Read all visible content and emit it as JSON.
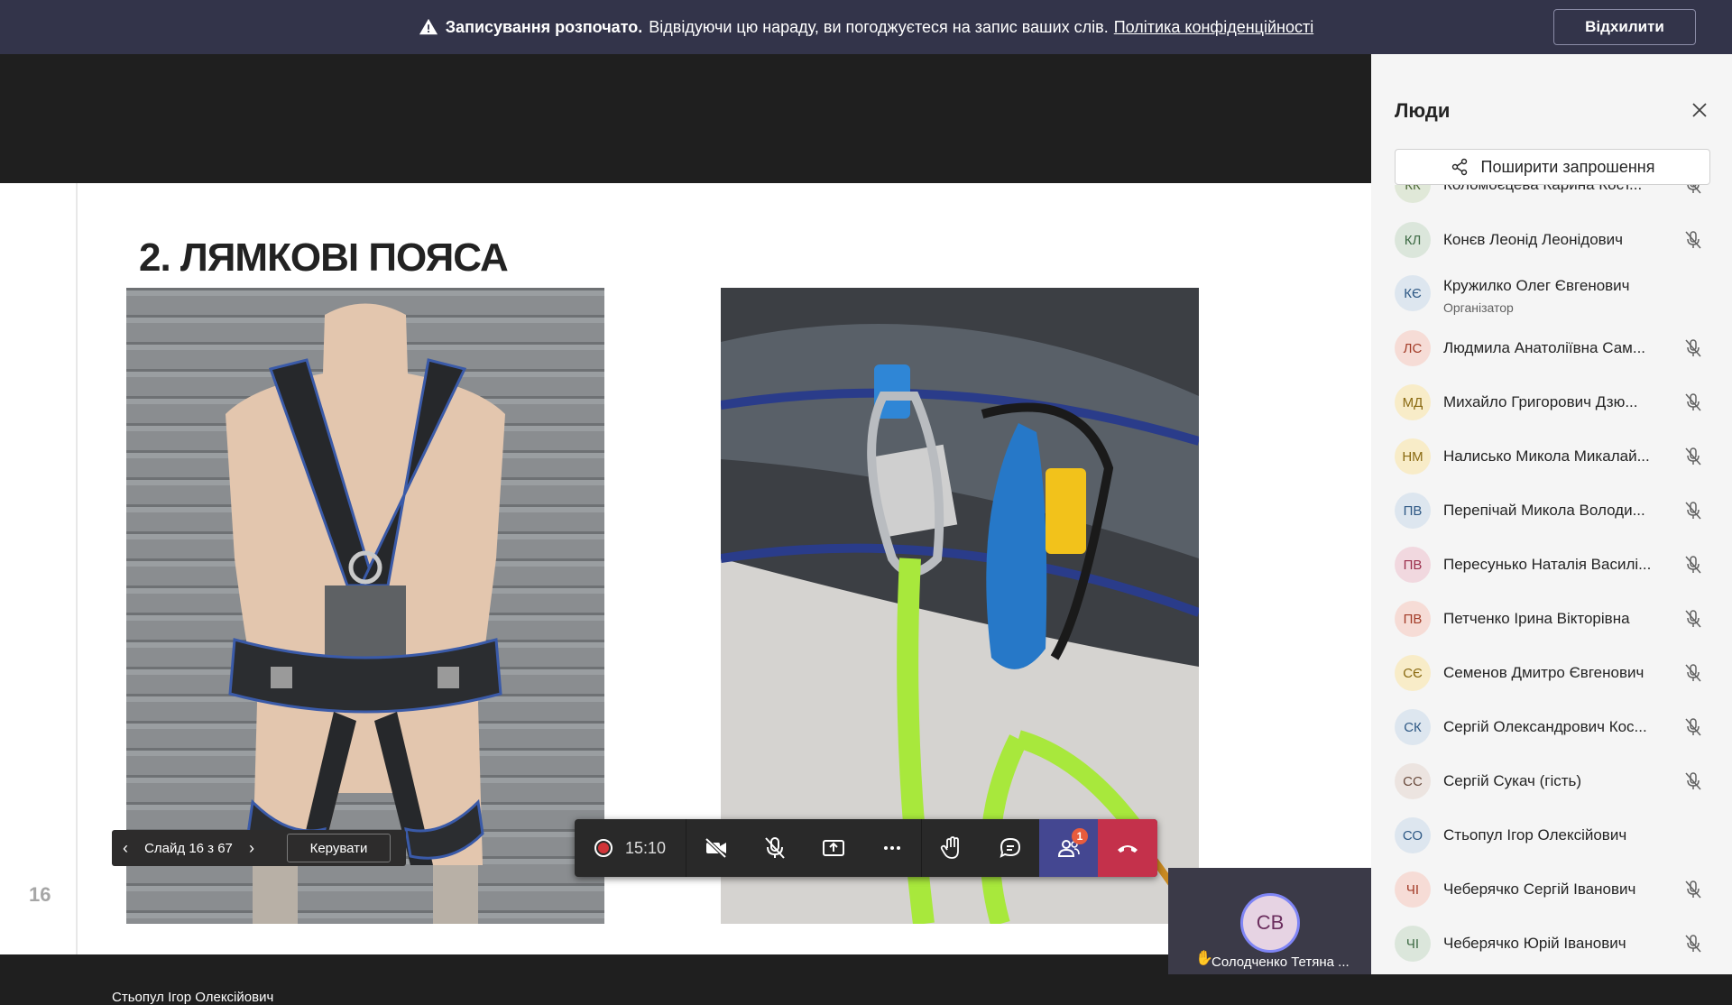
{
  "banner": {
    "bold": "Записування розпочато.",
    "text": "Відвідуючи цю нараду, ви погоджуєтеся на запис ваших слів.",
    "policy": "Політика конфіденційності",
    "dismiss": "Відхилити"
  },
  "slide": {
    "title": "2. ЛЯМКОВІ ПОЯСА",
    "number": "16"
  },
  "slidenav": {
    "counter": "Слайд 16 з 67",
    "manage": "Керувати"
  },
  "presenter": "Стьопул Ігор Олексійович",
  "controls": {
    "timer": "15:10",
    "people_badge": "1"
  },
  "tile": {
    "initials": "СВ",
    "name": "Солодченко Тетяна ..."
  },
  "panel": {
    "title": "Люди",
    "share": "Поширити запрошення",
    "people": [
      {
        "initials": "КК",
        "name": "Коломоєцева Карина Кост...",
        "color": "#e0e8d8",
        "fg": "#4f6b3a",
        "muted": true,
        "role": ""
      },
      {
        "initials": "КЛ",
        "name": "Конєв Леонід Леонідович",
        "color": "#dbe6db",
        "fg": "#3e6b45",
        "muted": true,
        "role": ""
      },
      {
        "initials": "КЄ",
        "name": "Кружилко Олег Євгенович",
        "color": "#dde6ef",
        "fg": "#2f5985",
        "muted": false,
        "role": "Організатор"
      },
      {
        "initials": "ЛС",
        "name": "Людмила Анатоліївна Сам...",
        "color": "#f6dcd6",
        "fg": "#a33c28",
        "muted": true,
        "role": ""
      },
      {
        "initials": "МД",
        "name": "Михайло Григорович Дзю...",
        "color": "#f8ecc8",
        "fg": "#8a6a12",
        "muted": true,
        "role": ""
      },
      {
        "initials": "НМ",
        "name": "Налисько Микола Микалай...",
        "color": "#f8ecc8",
        "fg": "#8a6a12",
        "muted": true,
        "role": ""
      },
      {
        "initials": "ПВ",
        "name": "Перепічай Микола Володи...",
        "color": "#dde6ef",
        "fg": "#2f5985",
        "muted": true,
        "role": ""
      },
      {
        "initials": "ПВ",
        "name": "Пересунько Наталія Василі...",
        "color": "#f1d8df",
        "fg": "#9b2e4c",
        "muted": true,
        "role": ""
      },
      {
        "initials": "ПВ",
        "name": "Петченко Ірина Вікторівна",
        "color": "#f6dcd6",
        "fg": "#a33c28",
        "muted": true,
        "role": ""
      },
      {
        "initials": "СЄ",
        "name": "Семенов Дмитро Євгенович",
        "color": "#f8ecc8",
        "fg": "#8a6a12",
        "muted": true,
        "role": ""
      },
      {
        "initials": "СК",
        "name": "Сергій Олександрович Кос...",
        "color": "#dde6ef",
        "fg": "#2f5985",
        "muted": true,
        "role": ""
      },
      {
        "initials": "СС",
        "name": "Сергій Сукач (гість)",
        "color": "#ece4e0",
        "fg": "#6b4c3e",
        "muted": true,
        "role": ""
      },
      {
        "initials": "СО",
        "name": "Стьопул Ігор Олексійович",
        "color": "#dde6ef",
        "fg": "#2f5985",
        "muted": false,
        "role": ""
      },
      {
        "initials": "ЧІ",
        "name": "Чеберячко Сергій Іванович",
        "color": "#f6dcd6",
        "fg": "#a33c28",
        "muted": true,
        "role": ""
      },
      {
        "initials": "ЧІ",
        "name": "Чеберячко Юрій Іванович",
        "color": "#dbe6db",
        "fg": "#3e6b45",
        "muted": true,
        "role": ""
      }
    ]
  }
}
